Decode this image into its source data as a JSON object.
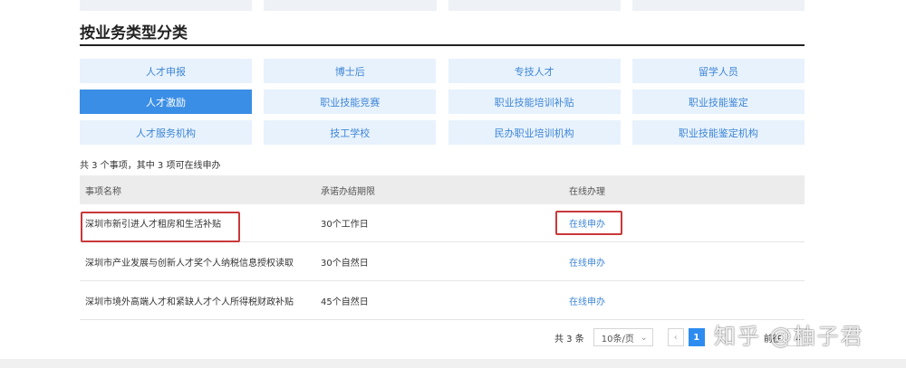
{
  "section_title": "按业务类型分类",
  "categories": [
    "人才申报",
    "博士后",
    "专技人才",
    "留学人员",
    "人才激励",
    "职业技能竞赛",
    "职业技能培训补贴",
    "职业技能鉴定",
    "人才服务机构",
    "技工学校",
    "民办职业培训机构",
    "职业技能鉴定机构"
  ],
  "active_category": "人才激励",
  "summary": "共 3 个事项，其中 3 项可在线申办",
  "table": {
    "headers": [
      "事项名称",
      "承诺办结期限",
      "在线办理"
    ],
    "rows": [
      {
        "name": "深圳市新引进人才租房和生活补贴",
        "deadline": "30个工作日",
        "action": "在线申办"
      },
      {
        "name": "深圳市产业发展与创新人才奖个人纳税信息授权读取",
        "deadline": "30个自然日",
        "action": "在线申办"
      },
      {
        "name": "深圳市境外高端人才和紧缺人才个人所得税财政补贴",
        "deadline": "45个自然日",
        "action": "在线申办"
      }
    ]
  },
  "pagination": {
    "total": "共 3 条",
    "page_size": "10条/页",
    "prev": "‹",
    "current_page": "1",
    "goto_label": "前往",
    "goto_value": "1"
  },
  "watermark": "知乎 @柚子君",
  "colors": {
    "accent": "#3a8ee6",
    "highlight": "#c9383a",
    "link": "#3e86d6"
  }
}
